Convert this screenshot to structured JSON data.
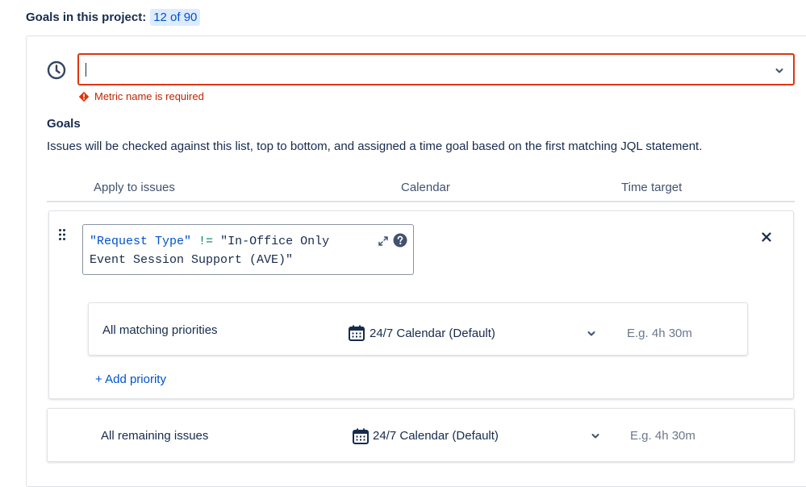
{
  "header": {
    "label": "Goals in this project:",
    "count_badge": "12 of 90"
  },
  "metric": {
    "value": "",
    "icon": "clock-icon",
    "dropdown_icon": "chevron-down-icon",
    "error_text": "Metric name is required"
  },
  "goals": {
    "title": "Goals",
    "description": "Issues will be checked against this list, top to bottom, and assigned a time goal based on the first matching JQL statement."
  },
  "columns": {
    "apply": "Apply to issues",
    "calendar": "Calendar",
    "time_target": "Time target"
  },
  "goal_card": {
    "jql_field": "\"Request Type\"",
    "jql_operator": "!=",
    "jql_value": "\"In-Office Only Event Session Support (AVE)\"",
    "priority_row": {
      "label": "All matching priorities",
      "calendar": "24/7 Calendar (Default)",
      "time_placeholder": "E.g. 4h 30m"
    },
    "add_priority": "+ Add priority"
  },
  "remaining": {
    "label": "All remaining issues",
    "calendar": "24/7 Calendar (Default)",
    "time_placeholder": "E.g. 4h 30m"
  },
  "colors": {
    "error": "#de350b",
    "link": "#0052cc",
    "badge_bg": "#deebff",
    "text": "#172b4d"
  }
}
